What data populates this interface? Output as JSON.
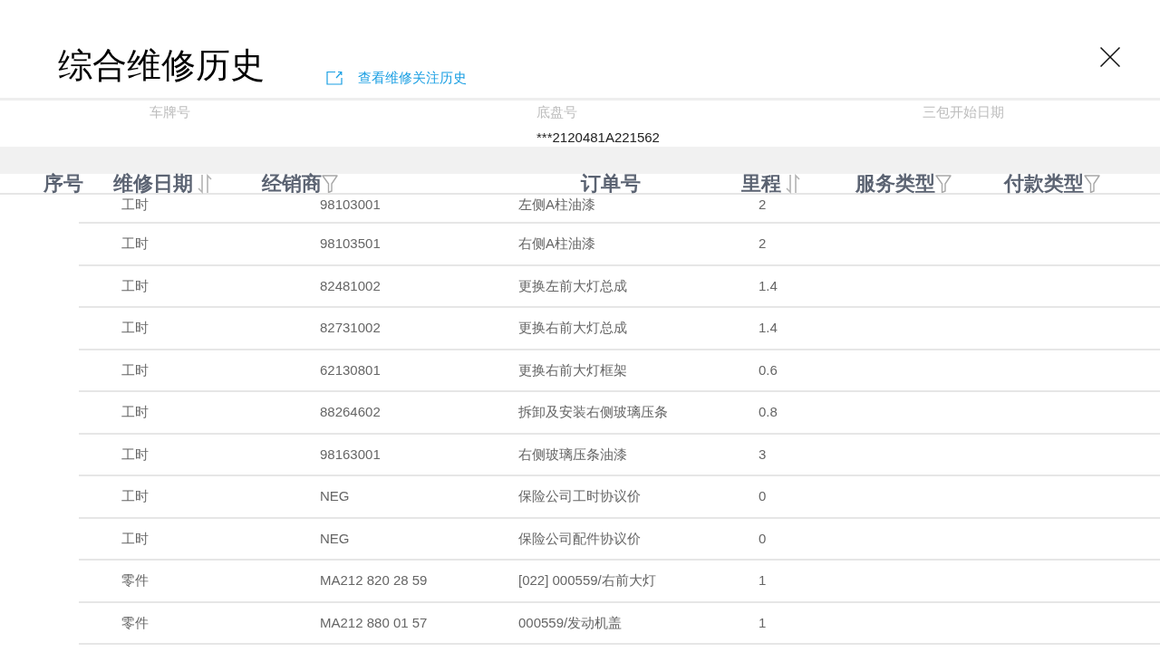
{
  "dialog": {
    "title": "综合维修历史",
    "link": {
      "label": "查看维修关注历史"
    }
  },
  "vehicle_fields": [
    {
      "label": "车牌号"
    },
    {
      "label": "底盘号",
      "value": "***2120481A221562"
    },
    {
      "label": "三包开始日期"
    }
  ],
  "header_bar": {
    "items": [
      {
        "label": "序号",
        "kind": "plain"
      },
      {
        "label": "维修日期",
        "kind": "sort"
      },
      {
        "label": "经销商",
        "kind": "filter"
      },
      {
        "label": "订单号",
        "kind": "plain"
      },
      {
        "label": "里程",
        "kind": "sort"
      },
      {
        "label": "服务类型",
        "kind": "filter"
      },
      {
        "label": "付款类型",
        "kind": "filter"
      }
    ]
  },
  "table": {
    "rows": [
      {
        "cells": [
          "工时",
          "98103001",
          "左侧A柱油漆",
          "2"
        ]
      },
      {
        "cells": [
          "工时",
          "98103501",
          "右侧A柱油漆",
          "2"
        ]
      },
      {
        "cells": [
          "工时",
          "82481002",
          "更换左前大灯总成",
          "1.4"
        ]
      },
      {
        "cells": [
          "工时",
          "82731002",
          "更换右前大灯总成",
          "1.4"
        ]
      },
      {
        "cells": [
          "工时",
          "62130801",
          "更换右前大灯框架",
          "0.6"
        ]
      },
      {
        "cells": [
          "工时",
          "88264602",
          "拆卸及安装右侧玻璃压条",
          "0.8"
        ]
      },
      {
        "cells": [
          "工时",
          "98163001",
          "右侧玻璃压条油漆",
          "3"
        ]
      },
      {
        "cells": [
          "工时",
          "NEG",
          "保险公司工时协议价",
          "0"
        ]
      },
      {
        "cells": [
          "工时",
          "NEG",
          "保险公司配件协议价",
          "0"
        ]
      },
      {
        "cells": [
          "零件",
          "MA212 820 28 59",
          "[022] 000559/右前大灯",
          "1"
        ]
      },
      {
        "cells": [
          "零件",
          "MA212 880 01 57",
          "000559/发动机盖",
          "1"
        ]
      }
    ]
  }
}
